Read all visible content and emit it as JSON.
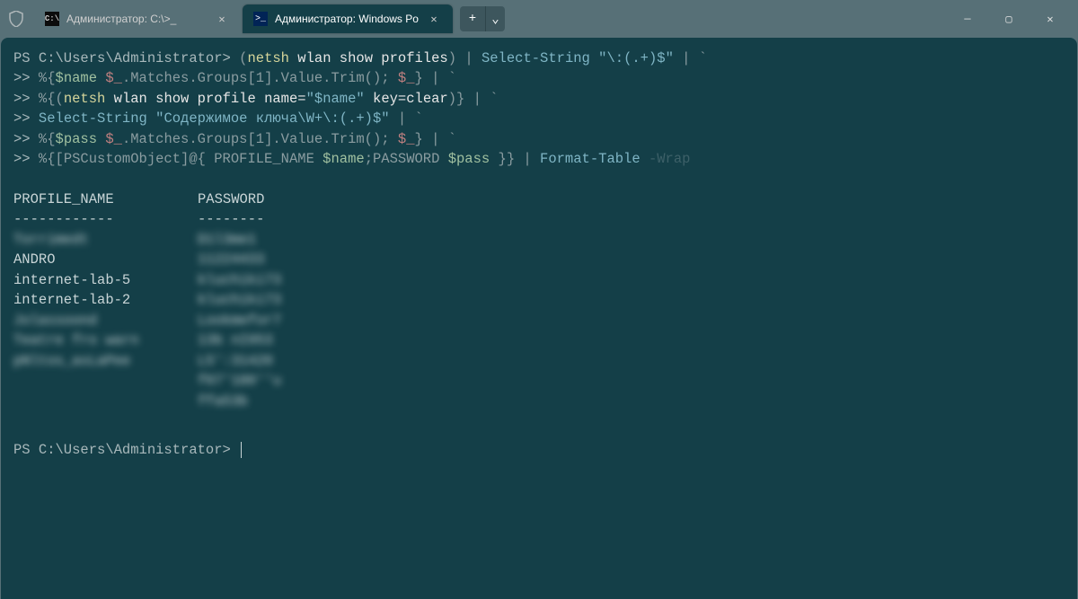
{
  "tabs": [
    {
      "label": "Администратор: C:\\>_",
      "icon_text": "C:\\",
      "active": false
    },
    {
      "label": "Администратор: Windows Po",
      "icon_text": ">_",
      "active": true
    }
  ],
  "window_controls": {
    "minimize": "—",
    "maximize": "▢",
    "close": "✕"
  },
  "newtab": "+",
  "dropdown": "⌄",
  "prompt_text": "PS C:\\Users\\Administrator>",
  "continuation": ">>",
  "code": {
    "l1_part1": "(",
    "l1_netsh": "netsh",
    "l1_wlan": " wlan show profiles",
    "l1_paren": ")",
    "l1_pipe": " | ",
    "l1_select": "Select-String",
    "l1_str": " \"\\:(.+)$\"",
    "l1_end": " | `",
    "l2_pct": " %{",
    "l2_var": "$name",
    "l2_dollar": " $_",
    "l2_matches": ".Matches.Groups[1].Value.Trim(); ",
    "l2_dollar2": "$_",
    "l2_end": "} | `",
    "l3_pct": " %{",
    "l3_paren1": "(",
    "l3_netsh": "netsh",
    "l3_wlan": " wlan show profile name=",
    "l3_str": "\"$name\"",
    "l3_key": " key=clear",
    "l3_paren2": ")} | `",
    "l4_sel": " Select-String",
    "l4_str": " \"Содержимое ключа\\W+\\:(.+)$\"",
    "l4_end": " | `",
    "l5_pct": " %{",
    "l5_var": "$pass",
    "l5_dollar": " $_",
    "l5_matches": ".Matches.Groups[1].Value.Trim(); ",
    "l5_dollar2": "$_",
    "l5_end": "} | `",
    "l6_pct": " %{",
    "l6_ps": "[PSCustomObject]",
    "l6_at": "@{ PROFILE_NAME ",
    "l6_name": "$name",
    "l6_semi": ";PASSWORD ",
    "l6_pass": "$pass",
    "l6_close": " }}",
    "l6_pipe": " | ",
    "l6_ft": "Format-Table",
    "l6_wrap": " -Wrap"
  },
  "table": {
    "header_name": "PROFILE_NAME",
    "header_pass": "PASSWORD",
    "divider_name": "------------",
    "divider_pass": "--------",
    "rows": [
      {
        "name": "Torrimedt",
        "pass": "D1l3me1",
        "blurred": true
      },
      {
        "name": "ANDRO",
        "pass": "11224433",
        "blurred": false,
        "blur_pass": true
      },
      {
        "name": "internet-lab-5",
        "pass": "kluchiki73",
        "blurred": false,
        "blur_pass": true
      },
      {
        "name": "internet-lab-2",
        "pass": "kluchiki73",
        "blurred": false,
        "blur_pass": true
      },
      {
        "name": "Jolassoond",
        "pass": "Lookmefor7",
        "blurred": true
      },
      {
        "name": "Teatre fro warn",
        "pass": "13b nI953",
        "blurred": true
      },
      {
        "name": "pNltos_asLaPee",
        "pass": "L5':31420",
        "blurred": true
      },
      {
        "name": "",
        "pass": "f07'180''u",
        "blurred": true
      },
      {
        "name": "",
        "pass": "ffa53b",
        "blurred": true
      }
    ]
  }
}
